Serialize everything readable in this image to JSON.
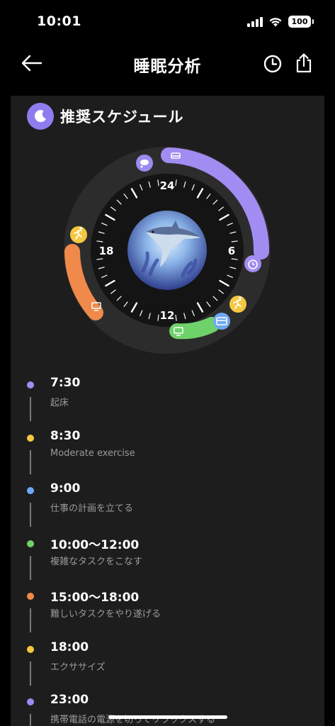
{
  "status_bar": {
    "time": "10:01",
    "battery": "100"
  },
  "nav": {
    "title": "睡眠分析"
  },
  "card": {
    "title": "推奨スケジュール",
    "dial_labels": {
      "top": "24",
      "right": "6",
      "bottom": "12",
      "left": "18"
    }
  },
  "timeline": [
    {
      "time": "7:30",
      "desc": "起床",
      "color": "#a18cf2"
    },
    {
      "time": "8:30",
      "desc": "Moderate exercise",
      "color": "#f5c842"
    },
    {
      "time": "9:00",
      "desc": "仕事の計画を立てる",
      "color": "#6fa8f5"
    },
    {
      "time": "10:00～12:00",
      "desc": "複雑なタスクをこなす",
      "color": "#6ed26a"
    },
    {
      "time": "15:00～18:00",
      "desc": "難しいタスクをやり遂げる",
      "color": "#f08a4b"
    },
    {
      "time": "18:00",
      "desc": "エクササイズ",
      "color": "#f5c842"
    },
    {
      "time": "23:00",
      "desc": "携帯電話の電源を切ってリラックスする",
      "color": "#9a8cf0"
    }
  ],
  "icons": {
    "back": "arrow-left-icon",
    "history": "clock-icon",
    "share": "share-icon",
    "title_badge": "moon-icon"
  },
  "colors": {
    "sleep_arc": "#a18cf2",
    "evening_work_arc": "#f08a4b",
    "morning_work_arc": "#6ed26a",
    "exercise": "#f5c842",
    "planning": "#6fa8f5"
  }
}
